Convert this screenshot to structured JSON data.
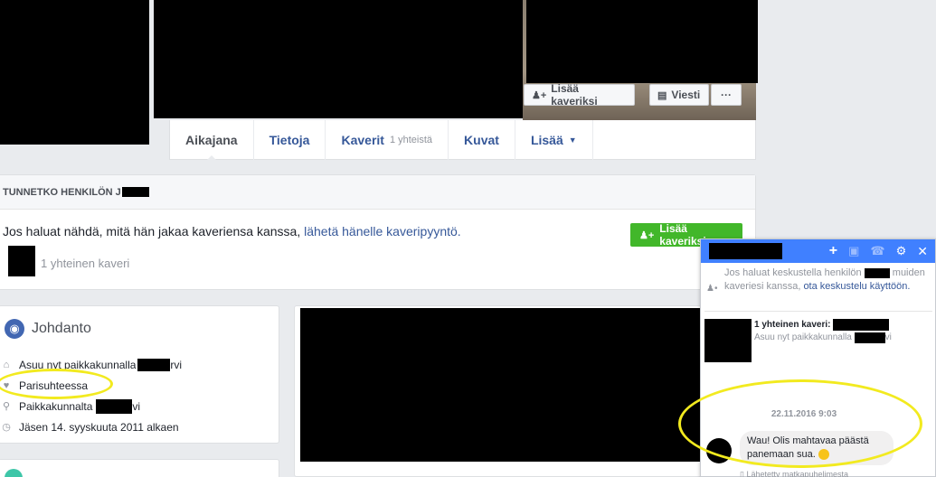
{
  "cover": {
    "add_friend_label": "Lisää kaveriksi",
    "message_label": "Viesti",
    "more_label": "···"
  },
  "nav": {
    "tabs": [
      {
        "label": "Aikajana"
      },
      {
        "label": "Tietoja"
      },
      {
        "label": "Kaverit",
        "count": "1 yhteistä"
      },
      {
        "label": "Kuvat"
      },
      {
        "label": "Lisää"
      }
    ]
  },
  "know_card": {
    "heading": "TUNNETKO HENKILÖN J",
    "text": "Jos haluat nähdä, mitä hän jakaa kaveriensa kanssa,",
    "link": "lähetä hänelle kaveripyyntö.",
    "mutual": "1 yhteinen kaveri",
    "add_friend_label": "Lisää kaveriksi"
  },
  "intro": {
    "title": "Johdanto",
    "rows": [
      {
        "icon": "home-icon",
        "text": "Asuu nyt paikkakunnalla",
        "suffix": "rvi"
      },
      {
        "icon": "heart-icon",
        "text": "Parisuhteessa",
        "suffix": ""
      },
      {
        "icon": "pin-icon",
        "text": "Paikkakunnalta",
        "suffix": "vi"
      },
      {
        "icon": "clock-icon",
        "text": "Jäsen 14. syyskuuta 2011 alkaen",
        "suffix": ""
      }
    ]
  },
  "chat": {
    "notice_text": "Jos haluat keskustella henkilön",
    "notice_text2": "muiden kaveriesi kanssa,",
    "notice_link": "ota keskustelu käyttöön.",
    "mutual_label": "1 yhteinen kaveri:",
    "lives_label": "Asuu nyt paikkakunnalla",
    "lives_suffix": "vi",
    "timestamp": "22.11.2016 9:03",
    "message_line1": "Wau! Olis mahtavaa päästä",
    "message_line2": "panemaan sua.",
    "sent_from": "Lähetetty matkapuhelimesta"
  },
  "colors": {
    "accent": "#4080ff",
    "green": "#42b72a",
    "link": "#365899",
    "highlight": "#f2ea1f"
  }
}
